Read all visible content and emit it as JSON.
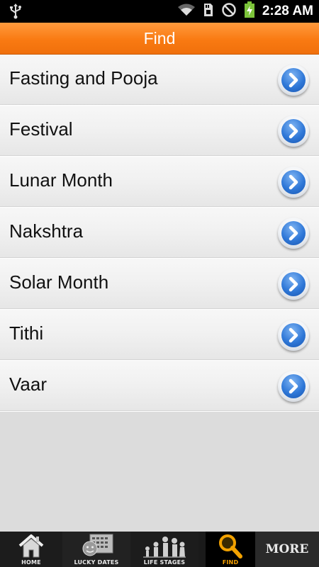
{
  "status_bar": {
    "time": "2:28 AM",
    "icons": [
      "usb-icon",
      "wifi-icon",
      "sd-card-icon",
      "no-signal-icon",
      "battery-charging-icon"
    ]
  },
  "header": {
    "title": "Find"
  },
  "list": {
    "items": [
      {
        "label": "Fasting and Pooja"
      },
      {
        "label": "Festival"
      },
      {
        "label": "Lunar Month"
      },
      {
        "label": "Nakshtra"
      },
      {
        "label": "Solar Month"
      },
      {
        "label": "Tithi"
      },
      {
        "label": "Vaar"
      }
    ]
  },
  "tabs": {
    "home": "HOME",
    "lucky_dates": "LUCKY DATES",
    "life_stages": "LIFE STAGES",
    "find": "FIND",
    "more": "MORE",
    "active": "find"
  },
  "colors": {
    "header": "#f97a12",
    "active_tab_label": "#f6a000",
    "arrow": "#2f78d8"
  }
}
